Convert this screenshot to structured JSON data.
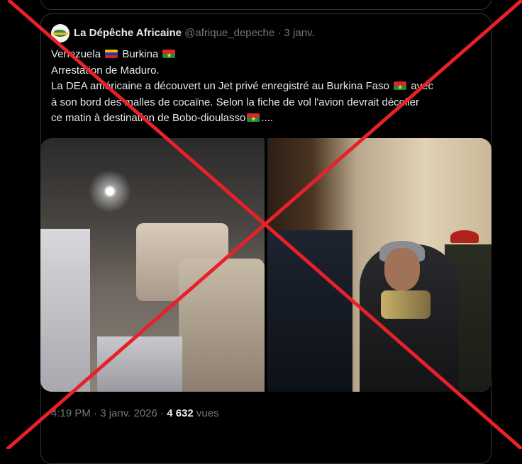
{
  "post": {
    "author_name": "La Dépêche Africaine",
    "handle": "@afrique_depeche",
    "dot": "·",
    "date": "3 janv.",
    "line1_a": "Venezuela ",
    "line1_b": " Burkina ",
    "line2": "Arrestation de Maduro.",
    "line3_a": "La DEA américaine a découvert un Jet privé enregistré au Burkina Faso ",
    "line3_b": " avec",
    "line4": "à son bord des malles de cocaïne. Selon la fiche de vol l'avion devrait décoller",
    "line5_a": "ce matin à destination de Bobo-dioulasso",
    "line5_b": "....",
    "flags": [
      "venezuela-flag",
      "burkina-faso-flag"
    ]
  },
  "meta": {
    "time": "4:19 PM",
    "sep": "·",
    "date": "3 janv. 2026",
    "views_count": "4 632",
    "views_label": "vues"
  },
  "colors": {
    "background": "#000000",
    "border": "#2f3336",
    "text": "#e7e9ea",
    "muted": "#71767b",
    "cross": "#e8202a"
  }
}
